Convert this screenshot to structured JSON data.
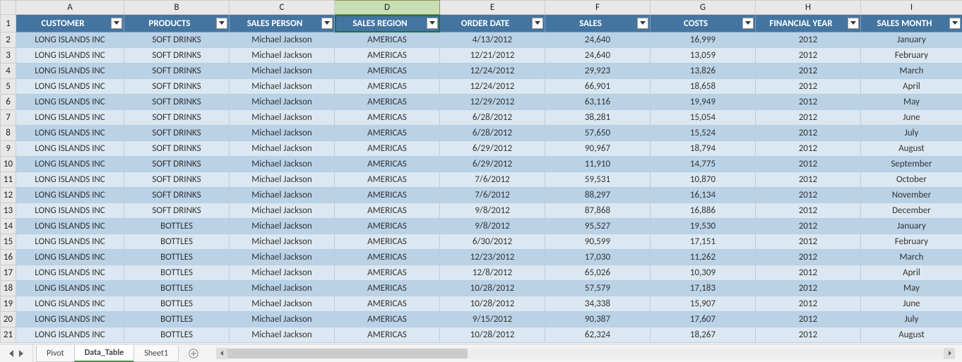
{
  "columns": [
    "A",
    "B",
    "C",
    "D",
    "E",
    "F",
    "G",
    "H",
    "I"
  ],
  "selected_column": "D",
  "headers": [
    {
      "key": "CUSTOMER",
      "label": "CUSTOMER"
    },
    {
      "key": "PRODUCTS",
      "label": "PRODUCTS"
    },
    {
      "key": "SALES_PERSON",
      "label": "SALES PERSON"
    },
    {
      "key": "SALES_REGION",
      "label": "SALES REGION"
    },
    {
      "key": "ORDER_DATE",
      "label": "ORDER DATE"
    },
    {
      "key": "SALES",
      "label": "SALES"
    },
    {
      "key": "COSTS",
      "label": "COSTS"
    },
    {
      "key": "FINANCIAL_YEAR",
      "label": "FINANCIAL YEAR"
    },
    {
      "key": "SALES_MONTH",
      "label": "SALES MONTH"
    }
  ],
  "rows": [
    {
      "CUSTOMER": "LONG ISLANDS INC",
      "PRODUCTS": "SOFT DRINKS",
      "SALES_PERSON": "Michael Jackson",
      "SALES_REGION": "AMERICAS",
      "ORDER_DATE": "4/13/2012",
      "SALES": "24,640",
      "COSTS": "16,999",
      "FINANCIAL_YEAR": "2012",
      "SALES_MONTH": "January"
    },
    {
      "CUSTOMER": "LONG ISLANDS INC",
      "PRODUCTS": "SOFT DRINKS",
      "SALES_PERSON": "Michael Jackson",
      "SALES_REGION": "AMERICAS",
      "ORDER_DATE": "12/21/2012",
      "SALES": "24,640",
      "COSTS": "13,059",
      "FINANCIAL_YEAR": "2012",
      "SALES_MONTH": "February"
    },
    {
      "CUSTOMER": "LONG ISLANDS INC",
      "PRODUCTS": "SOFT DRINKS",
      "SALES_PERSON": "Michael Jackson",
      "SALES_REGION": "AMERICAS",
      "ORDER_DATE": "12/24/2012",
      "SALES": "29,923",
      "COSTS": "13,826",
      "FINANCIAL_YEAR": "2012",
      "SALES_MONTH": "March"
    },
    {
      "CUSTOMER": "LONG ISLANDS INC",
      "PRODUCTS": "SOFT DRINKS",
      "SALES_PERSON": "Michael Jackson",
      "SALES_REGION": "AMERICAS",
      "ORDER_DATE": "12/24/2012",
      "SALES": "66,901",
      "COSTS": "18,658",
      "FINANCIAL_YEAR": "2012",
      "SALES_MONTH": "April"
    },
    {
      "CUSTOMER": "LONG ISLANDS INC",
      "PRODUCTS": "SOFT DRINKS",
      "SALES_PERSON": "Michael Jackson",
      "SALES_REGION": "AMERICAS",
      "ORDER_DATE": "12/29/2012",
      "SALES": "63,116",
      "COSTS": "19,949",
      "FINANCIAL_YEAR": "2012",
      "SALES_MONTH": "May"
    },
    {
      "CUSTOMER": "LONG ISLANDS INC",
      "PRODUCTS": "SOFT DRINKS",
      "SALES_PERSON": "Michael Jackson",
      "SALES_REGION": "AMERICAS",
      "ORDER_DATE": "6/28/2012",
      "SALES": "38,281",
      "COSTS": "15,054",
      "FINANCIAL_YEAR": "2012",
      "SALES_MONTH": "June"
    },
    {
      "CUSTOMER": "LONG ISLANDS INC",
      "PRODUCTS": "SOFT DRINKS",
      "SALES_PERSON": "Michael Jackson",
      "SALES_REGION": "AMERICAS",
      "ORDER_DATE": "6/28/2012",
      "SALES": "57,650",
      "COSTS": "15,524",
      "FINANCIAL_YEAR": "2012",
      "SALES_MONTH": "July"
    },
    {
      "CUSTOMER": "LONG ISLANDS INC",
      "PRODUCTS": "SOFT DRINKS",
      "SALES_PERSON": "Michael Jackson",
      "SALES_REGION": "AMERICAS",
      "ORDER_DATE": "6/29/2012",
      "SALES": "90,967",
      "COSTS": "18,794",
      "FINANCIAL_YEAR": "2012",
      "SALES_MONTH": "August"
    },
    {
      "CUSTOMER": "LONG ISLANDS INC",
      "PRODUCTS": "SOFT DRINKS",
      "SALES_PERSON": "Michael Jackson",
      "SALES_REGION": "AMERICAS",
      "ORDER_DATE": "6/29/2012",
      "SALES": "11,910",
      "COSTS": "14,775",
      "FINANCIAL_YEAR": "2012",
      "SALES_MONTH": "September"
    },
    {
      "CUSTOMER": "LONG ISLANDS INC",
      "PRODUCTS": "SOFT DRINKS",
      "SALES_PERSON": "Michael Jackson",
      "SALES_REGION": "AMERICAS",
      "ORDER_DATE": "7/6/2012",
      "SALES": "59,531",
      "COSTS": "10,870",
      "FINANCIAL_YEAR": "2012",
      "SALES_MONTH": "October"
    },
    {
      "CUSTOMER": "LONG ISLANDS INC",
      "PRODUCTS": "SOFT DRINKS",
      "SALES_PERSON": "Michael Jackson",
      "SALES_REGION": "AMERICAS",
      "ORDER_DATE": "7/6/2012",
      "SALES": "88,297",
      "COSTS": "16,134",
      "FINANCIAL_YEAR": "2012",
      "SALES_MONTH": "November"
    },
    {
      "CUSTOMER": "LONG ISLANDS INC",
      "PRODUCTS": "SOFT DRINKS",
      "SALES_PERSON": "Michael Jackson",
      "SALES_REGION": "AMERICAS",
      "ORDER_DATE": "9/8/2012",
      "SALES": "87,868",
      "COSTS": "16,886",
      "FINANCIAL_YEAR": "2012",
      "SALES_MONTH": "December"
    },
    {
      "CUSTOMER": "LONG ISLANDS INC",
      "PRODUCTS": "BOTTLES",
      "SALES_PERSON": "Michael Jackson",
      "SALES_REGION": "AMERICAS",
      "ORDER_DATE": "9/8/2012",
      "SALES": "95,527",
      "COSTS": "19,530",
      "FINANCIAL_YEAR": "2012",
      "SALES_MONTH": "January"
    },
    {
      "CUSTOMER": "LONG ISLANDS INC",
      "PRODUCTS": "BOTTLES",
      "SALES_PERSON": "Michael Jackson",
      "SALES_REGION": "AMERICAS",
      "ORDER_DATE": "6/30/2012",
      "SALES": "90,599",
      "COSTS": "17,151",
      "FINANCIAL_YEAR": "2012",
      "SALES_MONTH": "February"
    },
    {
      "CUSTOMER": "LONG ISLANDS INC",
      "PRODUCTS": "BOTTLES",
      "SALES_PERSON": "Michael Jackson",
      "SALES_REGION": "AMERICAS",
      "ORDER_DATE": "12/23/2012",
      "SALES": "17,030",
      "COSTS": "11,262",
      "FINANCIAL_YEAR": "2012",
      "SALES_MONTH": "March"
    },
    {
      "CUSTOMER": "LONG ISLANDS INC",
      "PRODUCTS": "BOTTLES",
      "SALES_PERSON": "Michael Jackson",
      "SALES_REGION": "AMERICAS",
      "ORDER_DATE": "12/8/2012",
      "SALES": "65,026",
      "COSTS": "10,309",
      "FINANCIAL_YEAR": "2012",
      "SALES_MONTH": "April"
    },
    {
      "CUSTOMER": "LONG ISLANDS INC",
      "PRODUCTS": "BOTTLES",
      "SALES_PERSON": "Michael Jackson",
      "SALES_REGION": "AMERICAS",
      "ORDER_DATE": "10/28/2012",
      "SALES": "57,579",
      "COSTS": "17,183",
      "FINANCIAL_YEAR": "2012",
      "SALES_MONTH": "May"
    },
    {
      "CUSTOMER": "LONG ISLANDS INC",
      "PRODUCTS": "BOTTLES",
      "SALES_PERSON": "Michael Jackson",
      "SALES_REGION": "AMERICAS",
      "ORDER_DATE": "10/28/2012",
      "SALES": "34,338",
      "COSTS": "15,907",
      "FINANCIAL_YEAR": "2012",
      "SALES_MONTH": "June"
    },
    {
      "CUSTOMER": "LONG ISLANDS INC",
      "PRODUCTS": "BOTTLES",
      "SALES_PERSON": "Michael Jackson",
      "SALES_REGION": "AMERICAS",
      "ORDER_DATE": "9/15/2012",
      "SALES": "90,387",
      "COSTS": "17,607",
      "FINANCIAL_YEAR": "2012",
      "SALES_MONTH": "July"
    },
    {
      "CUSTOMER": "LONG ISLANDS INC",
      "PRODUCTS": "BOTTLES",
      "SALES_PERSON": "Michael Jackson",
      "SALES_REGION": "AMERICAS",
      "ORDER_DATE": "10/28/2012",
      "SALES": "62,324",
      "COSTS": "18,267",
      "FINANCIAL_YEAR": "2012",
      "SALES_MONTH": "August"
    }
  ],
  "tabs": [
    {
      "label": "Pivot",
      "active": false
    },
    {
      "label": "Data_Table",
      "active": true
    },
    {
      "label": "Sheet1",
      "active": false
    }
  ],
  "add_sheet_label": "+"
}
